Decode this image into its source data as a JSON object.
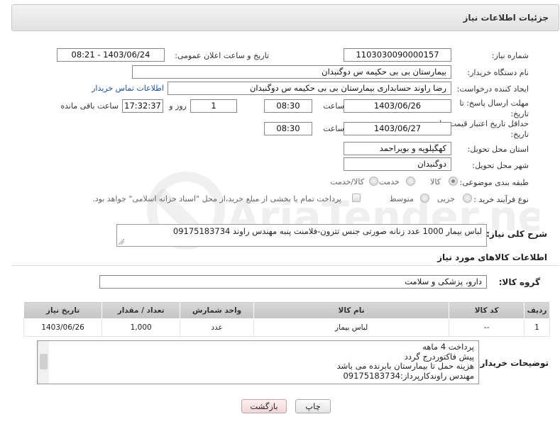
{
  "header": {
    "title": "جزئیات اطلاعات نیاز"
  },
  "need_number": {
    "label": "شماره نیاز:",
    "value": "1103030090000157"
  },
  "announce": {
    "label": "تاریخ و ساعت اعلان عمومی:",
    "value": "1403/06/24 - 08:21"
  },
  "buyer_org": {
    "label": "نام دستگاه خریدار:",
    "value": "بیمارستان بی بی حکیمه س  دوگنبدان"
  },
  "requester": {
    "label": "ایجاد کننده درخواست:",
    "value": "رضا راوند حسابداری بیمارستان بی بی حکیمه س  دوگنبدان",
    "contact_link": "اطلاعات تماس خریدار"
  },
  "reply_deadline": {
    "label": "مهلت ارسال پاسخ: تا تاریخ:",
    "date": "1403/06/26",
    "time_label": "ساعت",
    "time": "08:30",
    "days": "1",
    "days_label": "روز و",
    "remaining": "17:32:37",
    "remaining_label": "ساعت باقی مانده"
  },
  "price_validity": {
    "label": "حداقل تاریخ اعتبار قیمت: تا تاریخ:",
    "date": "1403/06/27",
    "time_label": "ساعت",
    "time": "08:30"
  },
  "province": {
    "label": "استان محل تحویل:",
    "value": "کهگیلویه و بویراحمد"
  },
  "city": {
    "label": "شهر محل تحویل:",
    "value": "دوگنبدان"
  },
  "category": {
    "label": "طبقه بندی موضوعی:",
    "options": [
      "کالا",
      "خدمت",
      "کالا/خدمت"
    ],
    "selected": "کالا"
  },
  "purchase_process": {
    "label": "نوع فرآیند خرید :",
    "options": [
      "جزیی",
      "متوسط"
    ],
    "note": "پرداخت تمام یا بخشی از مبلغ خرید،از محل \"اسناد خزانه اسلامی\" خواهد بود."
  },
  "summary": {
    "label": "شرح کلی نیاز:",
    "value": "لباس بیمار 1000 عدد زنانه صورتی جنس تترون-فلامنت پنبه مهندس راوند 09175183734"
  },
  "goods_info": {
    "title": "اطلاعات کالاهای مورد نیاز"
  },
  "goods_group": {
    "label": "گروه کالا:",
    "value": "دارو، پزشکی و سلامت"
  },
  "table": {
    "headers": [
      "ردیف",
      "کد کالا",
      "نام کالا",
      "واحد شمارش",
      "تعداد / مقدار",
      "تاریخ نیاز"
    ],
    "rows": [
      [
        "1",
        "--",
        "لباس بیمار",
        "عدد",
        "1,000",
        "1403/06/26"
      ]
    ]
  },
  "buyer_notes": {
    "label": "توضیحات خریدار:",
    "lines": [
      "پرداخت 4 ماهه",
      "پیش فاکتوردرج گردد",
      "هزینه حمل تا بیمارستان بابرنده می باشد",
      "مهندس راوندکارپرداز:09175183734"
    ]
  },
  "buttons": {
    "print": "چاپ",
    "back": "بازگشت"
  },
  "watermark": {
    "text": "AriaTender.neT"
  },
  "colors": {
    "link": "#1f4fa8",
    "header_bg": "#e8e8e8",
    "back_button": "#f0d6d6"
  }
}
